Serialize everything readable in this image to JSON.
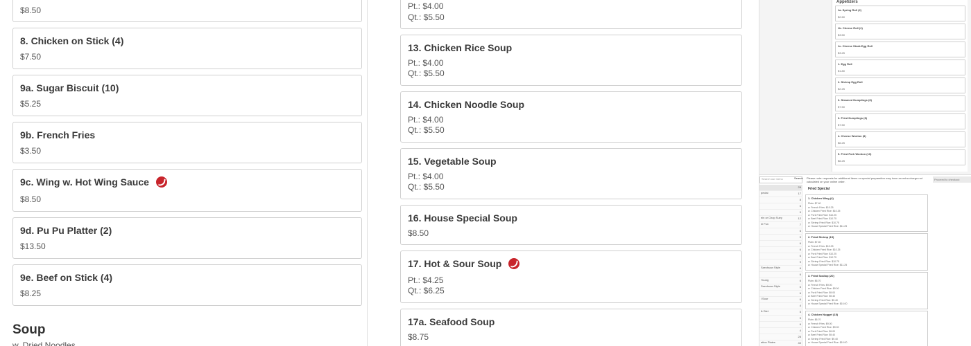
{
  "left_column": {
    "top_price": "$8.50",
    "items": [
      {
        "name": "8. Chicken on Stick (4)",
        "price": "$7.50",
        "spicy": false
      },
      {
        "name": "9a. Sugar Biscuit (10)",
        "price": "$5.25",
        "spicy": false
      },
      {
        "name": "9b. French Fries",
        "price": "$3.50",
        "spicy": false
      },
      {
        "name": "9c. Wing w. Hot Wing Sauce",
        "price": "$8.50",
        "spicy": true
      },
      {
        "name": "9d. Pu Pu Platter (2)",
        "price": "$13.50",
        "spicy": false
      },
      {
        "name": "9e. Beef on Stick (4)",
        "price": "$8.25",
        "spicy": false
      }
    ],
    "section_heading": "Soup",
    "section_sub": "w. Dried Noodles"
  },
  "middle_column": {
    "top_card": {
      "pt": "Pt.: $4.00",
      "qt": "Qt.: $5.50"
    },
    "items": [
      {
        "name": "13. Chicken Rice Soup",
        "pt": "Pt.: $4.00",
        "qt": "Qt.: $5.50",
        "spicy": false
      },
      {
        "name": "14. Chicken Noodle Soup",
        "pt": "Pt.: $4.00",
        "qt": "Qt.: $5.50",
        "spicy": false
      },
      {
        "name": "15. Vegetable Soup",
        "pt": "Pt.: $4.00",
        "qt": "Qt.: $5.50",
        "spicy": false
      },
      {
        "name": "16. House Special Soup",
        "price": "$8.50",
        "spicy": false
      },
      {
        "name": "17. Hot & Sour Soup",
        "pt": "Pt.: $4.25",
        "qt": "Qt.: $6.25",
        "spicy": true
      },
      {
        "name": "17a. Seafood Soup",
        "price": "$8.75",
        "spicy": false
      }
    ]
  },
  "thumbnail_top": {
    "heading": "Appetizers",
    "items": [
      {
        "name": "1a. Spring Roll (2)",
        "price": "$2.60"
      },
      {
        "name": "1b. Cheese Roll (2)",
        "price": "$3.50"
      },
      {
        "name": "1c. Cheese Steak Egg Roll",
        "price": "$3.25"
      },
      {
        "name": "1. Egg Roll",
        "price": "$1.80"
      },
      {
        "name": "2. Shrimp Egg Roll",
        "price": "$2.25"
      },
      {
        "name": "3. Steamed Dumplings (8)",
        "price": "$7.50"
      },
      {
        "name": "3. Fried Dumplings (8)",
        "price": "$7.50"
      },
      {
        "name": "4. Cheese Wonton (8)",
        "price": "$6.25"
      },
      {
        "name": "5. Fried Pork Wonton (10)",
        "price": "$6.25"
      }
    ]
  },
  "thumbnail_bottom": {
    "search_placeholder": "Search our menu",
    "search_button": "Search",
    "note": "Please note: requests for additional items or special preparation may incur an extra charge not calculated on your online order.",
    "checkout_button": "Proceed to checkout",
    "heading": "Fried Special",
    "categories": [
      {
        "label": "",
        "count": "28"
      },
      {
        "label": "pecial",
        "count": "17"
      },
      {
        "label": "",
        "count": "8"
      },
      {
        "label": "",
        "count": "6"
      },
      {
        "label": "",
        "count": "9"
      },
      {
        "label": "ein or Chop Suey",
        "count": "12"
      },
      {
        "label": "ei Fun",
        "count": "7"
      },
      {
        "label": "",
        "count": "6"
      },
      {
        "label": "",
        "count": "5"
      },
      {
        "label": "",
        "count": "6"
      },
      {
        "label": "",
        "count": "6"
      },
      {
        "label": "",
        "count": "6"
      },
      {
        "label": "",
        "count": "9"
      },
      {
        "label": "Szechuan Style",
        "count": "6"
      },
      {
        "label": "",
        "count": "6"
      },
      {
        "label": "Young",
        "count": "6"
      },
      {
        "label": "Szechuan Style",
        "count": "6"
      },
      {
        "label": "",
        "count": "6"
      },
      {
        "label": "l Sour",
        "count": "6"
      },
      {
        "label": "",
        "count": "4"
      },
      {
        "label": "& Diet",
        "count": "5"
      },
      {
        "label": "",
        "count": "5"
      },
      {
        "label": "",
        "count": "6"
      },
      {
        "label": "",
        "count": "4"
      },
      {
        "label": "",
        "count": "28"
      },
      {
        "label": "ation Plates",
        "count": "40"
      }
    ],
    "specials": [
      {
        "name": "1. Chicken Wing (4)",
        "lines": [
          "Plain: $7.40",
          "w. French Fries: $10.25",
          "w. Chicken Fried Rice: $10.25",
          "w. Pork Fried Rice: $10.25",
          "w. Beef Fried Rice: $10.75",
          "w. Shrimp Fried Rice: $10.75",
          "w. House Special Fried Rice: $11.25"
        ]
      },
      {
        "name": "2. Fried Shrimp (15)",
        "lines": [
          "Plain: $7.40",
          "w. French Fries: $10.25",
          "w. Chicken Fried Rice: $10.25",
          "w. Pork Fried Rice: $10.25",
          "w. Beef Fried Rice: $10.75",
          "w. Shrimp Fried Rice: $10.75",
          "w. House Special Fried Rice: $11.25"
        ]
      },
      {
        "name": "3. Fried Scallop (20)",
        "lines": [
          "Plain: $6.70",
          "w. French Fries: $9.00",
          "w. Chicken Fried Rice: $9.00",
          "w. Pork Fried Rice: $9.00",
          "w. Beef Fried Rice: $9.40",
          "w. Shrimp Fried Rice: $9.40",
          "w. House Special Fried Rice: $10.00"
        ]
      },
      {
        "name": "4. Chicken Nugget (15)",
        "lines": [
          "Plain: $6.70",
          "w. French Fries: $9.00",
          "w. Chicken Fried Rice: $9.00",
          "w. Pork Fried Rice: $9.00",
          "w. Beef Fried Rice: $9.40",
          "w. Shrimp Fried Rice: $9.40",
          "w. House Special Fried Rice: $10.00"
        ]
      }
    ]
  },
  "colors": {
    "spicy_icon": "#c8242b",
    "card_border": "#cfcfcf"
  }
}
